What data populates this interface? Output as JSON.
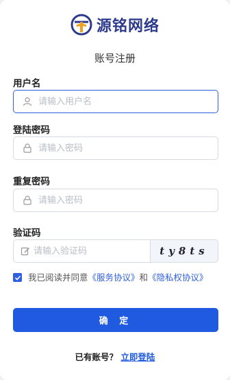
{
  "brand": {
    "name": "源铭网络",
    "color": "#2d3a8c",
    "accent": "#f0a020"
  },
  "page": {
    "subtitle": "账号注册"
  },
  "form": {
    "username": {
      "label": "用户名",
      "placeholder": "请输入用户名",
      "icon": "user-icon"
    },
    "password": {
      "label": "登陆密码",
      "placeholder": "请输入密码",
      "icon": "lock-icon"
    },
    "confirm_password": {
      "label": "重复密码",
      "placeholder": "请输入密码",
      "icon": "lock-icon"
    },
    "captcha": {
      "label": "验证码",
      "placeholder": "请输入验证码",
      "icon": "edit-icon",
      "image_text": "ty8ts"
    }
  },
  "agreement": {
    "prefix": "我已阅读并同意",
    "terms": "《服务协议》",
    "and": "和",
    "privacy": "《隐私权协议》",
    "checked": true
  },
  "submit": {
    "label": "确 定",
    "color": "#1f5ae0"
  },
  "footer": {
    "prompt": "已有账号？",
    "link": "立即登陆"
  }
}
